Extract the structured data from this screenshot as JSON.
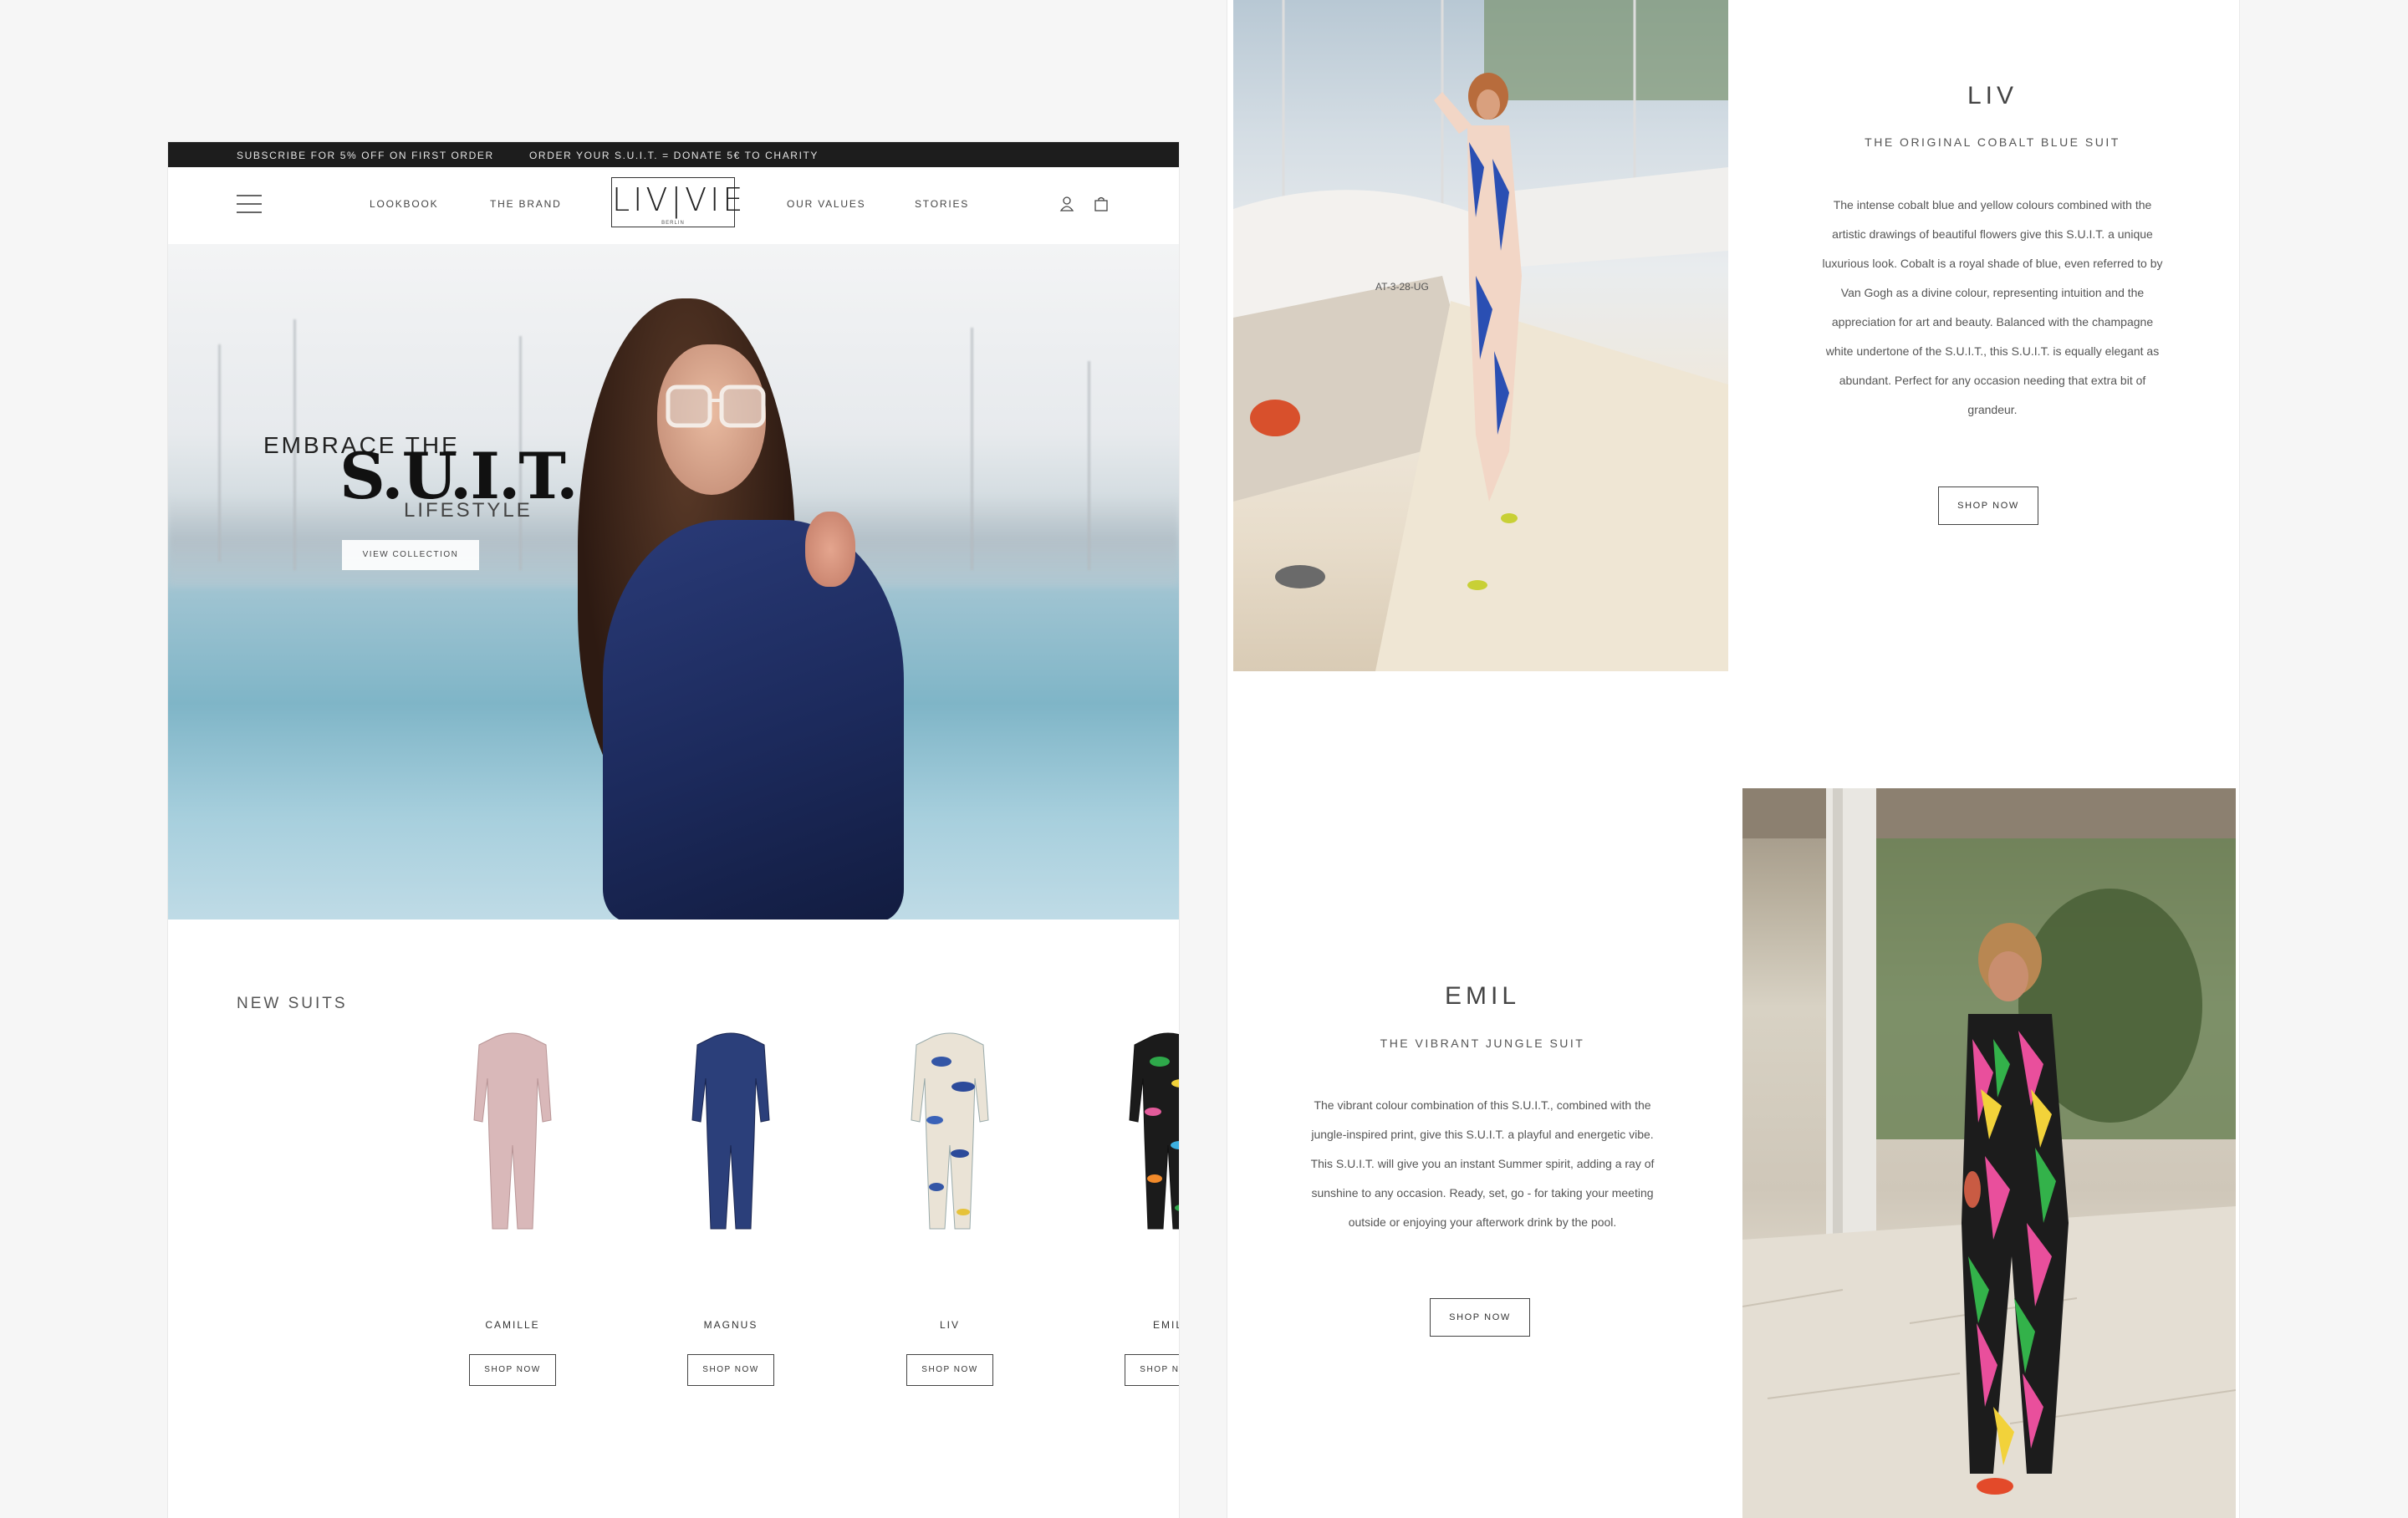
{
  "promo": {
    "left": "SUBSCRIBE FOR 5% OFF ON FIRST ORDER",
    "right": "ORDER YOUR S.U.I.T. = DONATE 5€ TO CHARITY"
  },
  "nav": {
    "links": [
      "LOOKBOOK",
      "THE BRAND",
      "OUR VALUES",
      "STORIES"
    ],
    "logo": "LIV|VIE",
    "logo_sub": "BERLIN",
    "icons": [
      "menu-icon",
      "user-icon",
      "bag-icon"
    ]
  },
  "hero": {
    "line1": "EMBRACE THE",
    "line2": "S.U.I.T.",
    "line3": "LIFESTYLE",
    "button": "VIEW COLLECTION"
  },
  "new_suits": {
    "title": "NEW SUITS",
    "items": [
      {
        "name": "CAMILLE",
        "button": "SHOP NOW",
        "color": "#d6b3b4"
      },
      {
        "name": "MAGNUS",
        "button": "SHOP NOW",
        "color": "#2a3d76"
      },
      {
        "name": "LIV",
        "button": "SHOP NOW",
        "color": "#3456a6"
      },
      {
        "name": "EMIL",
        "button": "SHOP NOW",
        "color": "#2b8a3e"
      }
    ]
  },
  "liv": {
    "name": "LIV",
    "subtitle": "THE ORIGINAL COBALT BLUE SUIT",
    "lines": [
      "The intense cobalt blue and yellow colours combined with the",
      "artistic drawings of beautiful flowers give this S.U.I.T. a unique",
      "luxurious look. Cobalt is a royal shade of blue, even referred to by",
      "Van Gogh as a divine colour, representing intuition and the",
      "appreciation for art and beauty. Balanced with the champagne",
      "white undertone of the S.U.I.T., this S.U.I.T. is equally elegant as",
      "abundant. Perfect for any occasion needing that extra bit of",
      "grandeur."
    ],
    "button": "SHOP NOW",
    "boat_text": "AT-3-28-UG"
  },
  "emil": {
    "name": "EMIL",
    "subtitle": "THE VIBRANT JUNGLE SUIT",
    "lines": [
      "The vibrant colour combination of this S.U.I.T., combined with the",
      "jungle-inspired print, give this S.U.I.T. a playful and energetic vibe.",
      "This S.U.I.T. will give you an instant Summer spirit, adding a ray of",
      "sunshine to any occasion. Ready, set, go - for taking your meeting",
      "outside or enjoying your afterwork drink by the pool."
    ],
    "button": "SHOP NOW"
  }
}
